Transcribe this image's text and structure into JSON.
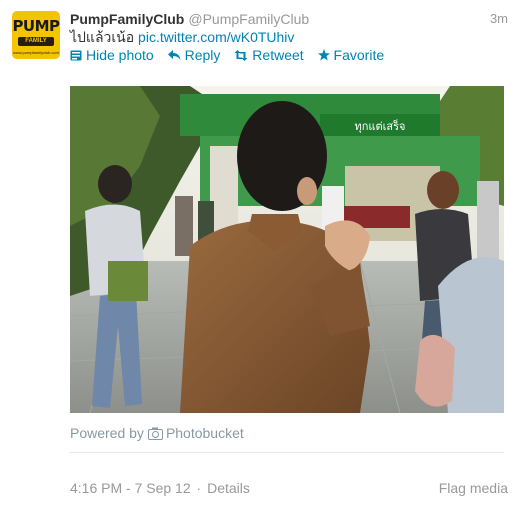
{
  "user": {
    "full_name": "PumpFamilyClub",
    "screen_name": "@PumpFamilyClub",
    "avatar": {
      "logo_text": "PUMP",
      "logo_sub": "FAMILY CLUB",
      "logo_url": "www.pumpfamilyclub.com"
    }
  },
  "tweet": {
    "timestamp_relative": "3m",
    "text_prefix": "ไปแล้วเน้อ",
    "link": "pic.twitter.com/wK0TUhiv"
  },
  "actions": {
    "hide_photo": "Hide photo",
    "reply": "Reply",
    "retweet": "Retweet",
    "favorite": "Favorite"
  },
  "media": {
    "powered_by": "Powered by",
    "provider": "Photobucket",
    "sign_text": "ทุกแต่เสร็จ"
  },
  "details": {
    "datetime": "4:16 PM - 7 Sep 12",
    "separator": "·",
    "details_link": "Details",
    "flag_media": "Flag media"
  },
  "colors": {
    "link": "#0084b4",
    "muted": "#999999",
    "name": "#333333",
    "avatar_bg": "#f5c400"
  },
  "icons": {
    "hide_photo": "photo-icon",
    "reply": "reply-arrow-icon",
    "retweet": "retweet-icon",
    "favorite": "star-icon",
    "provider": "camera-icon"
  }
}
